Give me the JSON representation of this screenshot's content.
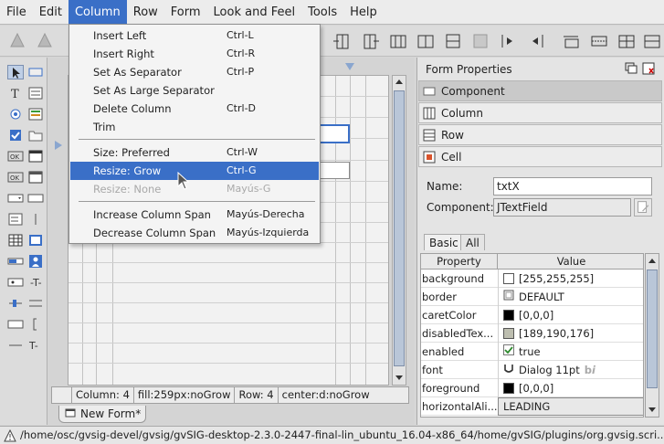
{
  "menubar": {
    "items": [
      "File",
      "Edit",
      "Column",
      "Row",
      "Form",
      "Look and Feel",
      "Tools",
      "Help"
    ],
    "active": "Column"
  },
  "column_menu": {
    "items": [
      {
        "label": "Insert Left",
        "shortcut": "Ctrl-L",
        "state": "normal"
      },
      {
        "label": "Insert Right",
        "shortcut": "Ctrl-R",
        "state": "normal"
      },
      {
        "label": "Set As Separator",
        "shortcut": "Ctrl-P",
        "state": "normal"
      },
      {
        "label": "Set As Large Separator",
        "shortcut": "",
        "state": "normal"
      },
      {
        "label": "Delete Column",
        "shortcut": "Ctrl-D",
        "state": "normal"
      },
      {
        "label": "Trim",
        "shortcut": "",
        "state": "normal"
      },
      {
        "label": "Size: Preferred",
        "shortcut": "Ctrl-W",
        "state": "normal"
      },
      {
        "label": "Resize: Grow",
        "shortcut": "Ctrl-G",
        "state": "highlighted"
      },
      {
        "label": "Resize: None",
        "shortcut": "Mayús-G",
        "state": "disabled"
      },
      {
        "label": "Increase Column Span",
        "shortcut": "Mayús-Derecha",
        "state": "normal"
      },
      {
        "label": "Decrease Column Span",
        "shortcut": "Mayús-Izquierda",
        "state": "normal"
      }
    ]
  },
  "designer": {
    "status": {
      "column": "Column: 4",
      "fill": "fill:259px:noGrow",
      "row": "Row: 4",
      "align": "center:d:noGrow"
    },
    "form_tab": "New Form*"
  },
  "form_properties": {
    "title": "Form Properties",
    "sections": [
      "Component",
      "Column",
      "Row",
      "Cell"
    ],
    "selected_section": "Component",
    "name_label": "Name:",
    "name_value": "txtX",
    "component_label": "Component:",
    "component_value": "JTextField",
    "tabs": [
      "Basic",
      "All"
    ],
    "active_tab": "Basic",
    "table": {
      "headers": [
        "Property",
        "Value"
      ],
      "rows": [
        {
          "name": "background",
          "value": "[255,255,255]",
          "swatch": "#ffffff"
        },
        {
          "name": "border",
          "value": "DEFAULT",
          "icon": "border-icon"
        },
        {
          "name": "caretColor",
          "value": "[0,0,0]",
          "swatch": "#000000"
        },
        {
          "name": "disabledTex...",
          "value": "[189,190,176]",
          "swatch": "#bdbeb0"
        },
        {
          "name": "enabled",
          "value": "true",
          "icon": "checkbox-icon"
        },
        {
          "name": "font",
          "value": "Dialog 11pt",
          "icon": "font-icon"
        },
        {
          "name": "foreground",
          "value": "[0,0,0]",
          "swatch": "#000000"
        },
        {
          "name": "horizontalAli...",
          "value": "LEADING"
        }
      ]
    }
  },
  "path_bar": "/home/osc/gvsig-devel/gvsig/gvSIG-desktop-2.3.0-2447-final-lin_ubuntu_16.04-x86_64/home/gvSIG/plugins/org.gvsig.scri...",
  "colors": {
    "menu_highlight": "#3a6fc7",
    "panel_bg": "#e4e4e4"
  }
}
